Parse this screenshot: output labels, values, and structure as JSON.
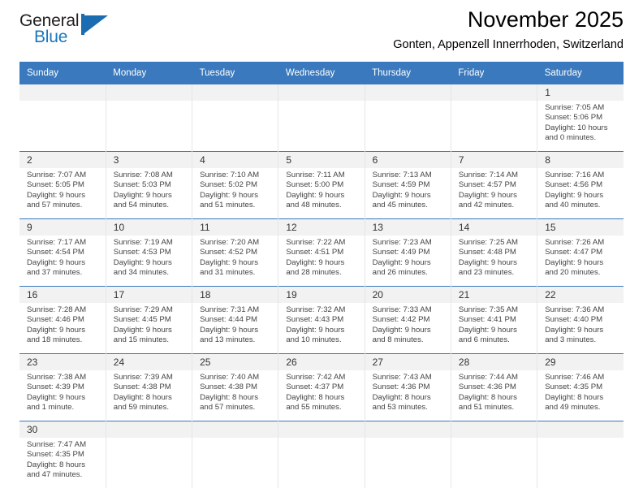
{
  "brand": {
    "name_part1": "General",
    "name_part2": "Blue",
    "accent_color": "#1b6cb0"
  },
  "header": {
    "month_title": "November 2025",
    "location": "Gonten, Appenzell Innerrhoden, Switzerland"
  },
  "calendar": {
    "header_color": "#3a79bd",
    "weekday_headers": [
      "Sunday",
      "Monday",
      "Tuesday",
      "Wednesday",
      "Thursday",
      "Friday",
      "Saturday"
    ],
    "weeks": [
      [
        {
          "empty": true
        },
        {
          "empty": true
        },
        {
          "empty": true
        },
        {
          "empty": true
        },
        {
          "empty": true
        },
        {
          "empty": true
        },
        {
          "day": "1",
          "sunrise": "Sunrise: 7:05 AM",
          "sunset": "Sunset: 5:06 PM",
          "daylight_line1": "Daylight: 10 hours",
          "daylight_line2": "and 0 minutes."
        }
      ],
      [
        {
          "day": "2",
          "sunrise": "Sunrise: 7:07 AM",
          "sunset": "Sunset: 5:05 PM",
          "daylight_line1": "Daylight: 9 hours",
          "daylight_line2": "and 57 minutes."
        },
        {
          "day": "3",
          "sunrise": "Sunrise: 7:08 AM",
          "sunset": "Sunset: 5:03 PM",
          "daylight_line1": "Daylight: 9 hours",
          "daylight_line2": "and 54 minutes."
        },
        {
          "day": "4",
          "sunrise": "Sunrise: 7:10 AM",
          "sunset": "Sunset: 5:02 PM",
          "daylight_line1": "Daylight: 9 hours",
          "daylight_line2": "and 51 minutes."
        },
        {
          "day": "5",
          "sunrise": "Sunrise: 7:11 AM",
          "sunset": "Sunset: 5:00 PM",
          "daylight_line1": "Daylight: 9 hours",
          "daylight_line2": "and 48 minutes."
        },
        {
          "day": "6",
          "sunrise": "Sunrise: 7:13 AM",
          "sunset": "Sunset: 4:59 PM",
          "daylight_line1": "Daylight: 9 hours",
          "daylight_line2": "and 45 minutes."
        },
        {
          "day": "7",
          "sunrise": "Sunrise: 7:14 AM",
          "sunset": "Sunset: 4:57 PM",
          "daylight_line1": "Daylight: 9 hours",
          "daylight_line2": "and 42 minutes."
        },
        {
          "day": "8",
          "sunrise": "Sunrise: 7:16 AM",
          "sunset": "Sunset: 4:56 PM",
          "daylight_line1": "Daylight: 9 hours",
          "daylight_line2": "and 40 minutes."
        }
      ],
      [
        {
          "day": "9",
          "sunrise": "Sunrise: 7:17 AM",
          "sunset": "Sunset: 4:54 PM",
          "daylight_line1": "Daylight: 9 hours",
          "daylight_line2": "and 37 minutes."
        },
        {
          "day": "10",
          "sunrise": "Sunrise: 7:19 AM",
          "sunset": "Sunset: 4:53 PM",
          "daylight_line1": "Daylight: 9 hours",
          "daylight_line2": "and 34 minutes."
        },
        {
          "day": "11",
          "sunrise": "Sunrise: 7:20 AM",
          "sunset": "Sunset: 4:52 PM",
          "daylight_line1": "Daylight: 9 hours",
          "daylight_line2": "and 31 minutes."
        },
        {
          "day": "12",
          "sunrise": "Sunrise: 7:22 AM",
          "sunset": "Sunset: 4:51 PM",
          "daylight_line1": "Daylight: 9 hours",
          "daylight_line2": "and 28 minutes."
        },
        {
          "day": "13",
          "sunrise": "Sunrise: 7:23 AM",
          "sunset": "Sunset: 4:49 PM",
          "daylight_line1": "Daylight: 9 hours",
          "daylight_line2": "and 26 minutes."
        },
        {
          "day": "14",
          "sunrise": "Sunrise: 7:25 AM",
          "sunset": "Sunset: 4:48 PM",
          "daylight_line1": "Daylight: 9 hours",
          "daylight_line2": "and 23 minutes."
        },
        {
          "day": "15",
          "sunrise": "Sunrise: 7:26 AM",
          "sunset": "Sunset: 4:47 PM",
          "daylight_line1": "Daylight: 9 hours",
          "daylight_line2": "and 20 minutes."
        }
      ],
      [
        {
          "day": "16",
          "sunrise": "Sunrise: 7:28 AM",
          "sunset": "Sunset: 4:46 PM",
          "daylight_line1": "Daylight: 9 hours",
          "daylight_line2": "and 18 minutes."
        },
        {
          "day": "17",
          "sunrise": "Sunrise: 7:29 AM",
          "sunset": "Sunset: 4:45 PM",
          "daylight_line1": "Daylight: 9 hours",
          "daylight_line2": "and 15 minutes."
        },
        {
          "day": "18",
          "sunrise": "Sunrise: 7:31 AM",
          "sunset": "Sunset: 4:44 PM",
          "daylight_line1": "Daylight: 9 hours",
          "daylight_line2": "and 13 minutes."
        },
        {
          "day": "19",
          "sunrise": "Sunrise: 7:32 AM",
          "sunset": "Sunset: 4:43 PM",
          "daylight_line1": "Daylight: 9 hours",
          "daylight_line2": "and 10 minutes."
        },
        {
          "day": "20",
          "sunrise": "Sunrise: 7:33 AM",
          "sunset": "Sunset: 4:42 PM",
          "daylight_line1": "Daylight: 9 hours",
          "daylight_line2": "and 8 minutes."
        },
        {
          "day": "21",
          "sunrise": "Sunrise: 7:35 AM",
          "sunset": "Sunset: 4:41 PM",
          "daylight_line1": "Daylight: 9 hours",
          "daylight_line2": "and 6 minutes."
        },
        {
          "day": "22",
          "sunrise": "Sunrise: 7:36 AM",
          "sunset": "Sunset: 4:40 PM",
          "daylight_line1": "Daylight: 9 hours",
          "daylight_line2": "and 3 minutes."
        }
      ],
      [
        {
          "day": "23",
          "sunrise": "Sunrise: 7:38 AM",
          "sunset": "Sunset: 4:39 PM",
          "daylight_line1": "Daylight: 9 hours",
          "daylight_line2": "and 1 minute."
        },
        {
          "day": "24",
          "sunrise": "Sunrise: 7:39 AM",
          "sunset": "Sunset: 4:38 PM",
          "daylight_line1": "Daylight: 8 hours",
          "daylight_line2": "and 59 minutes."
        },
        {
          "day": "25",
          "sunrise": "Sunrise: 7:40 AM",
          "sunset": "Sunset: 4:38 PM",
          "daylight_line1": "Daylight: 8 hours",
          "daylight_line2": "and 57 minutes."
        },
        {
          "day": "26",
          "sunrise": "Sunrise: 7:42 AM",
          "sunset": "Sunset: 4:37 PM",
          "daylight_line1": "Daylight: 8 hours",
          "daylight_line2": "and 55 minutes."
        },
        {
          "day": "27",
          "sunrise": "Sunrise: 7:43 AM",
          "sunset": "Sunset: 4:36 PM",
          "daylight_line1": "Daylight: 8 hours",
          "daylight_line2": "and 53 minutes."
        },
        {
          "day": "28",
          "sunrise": "Sunrise: 7:44 AM",
          "sunset": "Sunset: 4:36 PM",
          "daylight_line1": "Daylight: 8 hours",
          "daylight_line2": "and 51 minutes."
        },
        {
          "day": "29",
          "sunrise": "Sunrise: 7:46 AM",
          "sunset": "Sunset: 4:35 PM",
          "daylight_line1": "Daylight: 8 hours",
          "daylight_line2": "and 49 minutes."
        }
      ],
      [
        {
          "day": "30",
          "sunrise": "Sunrise: 7:47 AM",
          "sunset": "Sunset: 4:35 PM",
          "daylight_line1": "Daylight: 8 hours",
          "daylight_line2": "and 47 minutes."
        },
        {
          "empty": true
        },
        {
          "empty": true
        },
        {
          "empty": true
        },
        {
          "empty": true
        },
        {
          "empty": true
        },
        {
          "empty": true
        }
      ]
    ]
  }
}
